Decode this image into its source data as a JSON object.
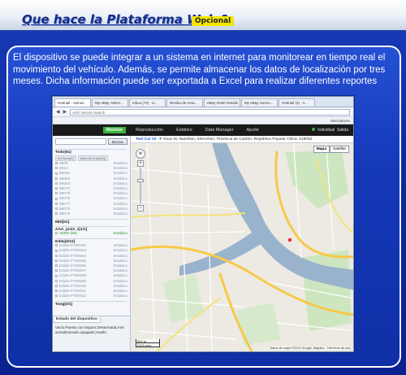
{
  "header": {
    "title": "Que hace la Plataforma Web ?",
    "badge": "Opcional"
  },
  "description": "El dispositivo se puede integrar a un sistema en internet para monitorear en tiempo real el movimiento del vehículo. Además, se permite almacenar los datos de localización por tres meses. Dicha información puede ser exportada a Excel para realizar diferentes reportes",
  "browser": {
    "tabs": [
      "Hotmail - samwi...",
      "My eBay: Mess...",
      "Inbox (72) - a...",
      "Recibo de Ama...",
      "eBay Order Details",
      "My eBay Summ...",
      "Hotmail (4) - s..."
    ],
    "address": "AVG Secure Search",
    "bookmarks": "Marcadores"
  },
  "app": {
    "nav": [
      "Monitor",
      "Reproducción",
      "Estático",
      "Data Manager",
      "Ajuste"
    ],
    "active_nav": "Monitor",
    "user": "Individual",
    "logout": "Salida"
  },
  "sidebar": {
    "search_button": "Buscar",
    "group_all": "Todo(61)",
    "filter_online": "En línea(0)",
    "filter_offline": "fuera de línea(34)",
    "devices_a": [
      {
        "name": "8809",
        "status": "Estático"
      },
      {
        "name": "8813",
        "status": "Estático"
      },
      {
        "name": "88081",
        "status": "Estático"
      },
      {
        "name": "88082",
        "status": "Estático"
      },
      {
        "name": "88083",
        "status": "Estático"
      },
      {
        "name": "88074",
        "status": "Estático"
      },
      {
        "name": "88075",
        "status": "Estático"
      },
      {
        "name": "88076",
        "status": "Estático"
      },
      {
        "name": "88077",
        "status": "Estático"
      },
      {
        "name": "88078",
        "status": "Estático"
      },
      {
        "name": "88079",
        "status": "Estático"
      }
    ],
    "group_m": "MID[01]",
    "group_aaa": "AAA_p/cl2_1[1/1]",
    "group_edda": "Edda[0/12]",
    "aaa_device": {
      "name": "VMID (00)",
      "status": "Estático"
    },
    "devices_b": [
      {
        "name": "Eddie-P700902",
        "status": "Estático"
      },
      {
        "name": "Eddie-P700903",
        "status": "Estático"
      },
      {
        "name": "Eddie-P700904",
        "status": "Estático"
      },
      {
        "name": "Eddie-P700905",
        "status": "Estático"
      },
      {
        "name": "Eddie-P700906",
        "status": "Estático"
      },
      {
        "name": "Eddie-P700907",
        "status": "Estático"
      },
      {
        "name": "Eddie-P700908",
        "status": "Estático"
      },
      {
        "name": "Eddie-P700909",
        "status": "Estático"
      },
      {
        "name": "Eddie-P700910",
        "status": "Estático"
      },
      {
        "name": "Eddie-P700911",
        "status": "Estático"
      },
      {
        "name": "Eddie-P700912",
        "status": "Estático"
      }
    ],
    "group_tong": "Tong[0/1]",
    "status_tab": "Estado del dispositivo",
    "status_text": "Vacío:Puerta con seguro;Desarmada;Aire acondicionado apagado;Asalto"
  },
  "map": {
    "device": "Test Car 02",
    "address": "Youxi St, Nanshan, Shenzhen, Provincia de Cantón, República Popular China, 518052",
    "types": [
      "Mapa",
      "Satélite"
    ],
    "selected_type": "Mapa",
    "scale_m": "500 m",
    "scale_ft": "2000 pies",
    "attribution": "Datos de mapa ©2013 Google, Mapabc - Términos de uso"
  }
}
